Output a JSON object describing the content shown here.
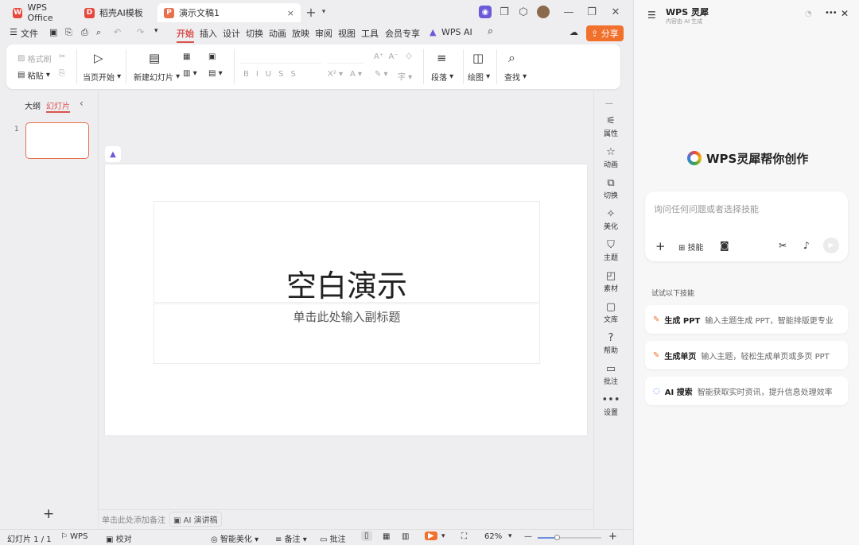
{
  "tabs": [
    {
      "label": "WPS Office",
      "icon": "wps-logo-icon"
    },
    {
      "label": "稻壳AI模板",
      "icon": "docer-icon"
    },
    {
      "label": "演示文稿1",
      "icon": "presentation-icon",
      "close": "×"
    }
  ],
  "menu": {
    "file": "文件",
    "items": [
      "开始",
      "插入",
      "设计",
      "切换",
      "动画",
      "放映",
      "审阅",
      "视图",
      "工具",
      "会员专享"
    ],
    "active": "开始",
    "wps_ai": "WPS AI",
    "share": "分享"
  },
  "ribbon": {
    "format_painter": "格式刷",
    "paste": "粘贴",
    "play_current": "当页开始",
    "new_slide": "新建幻灯片",
    "paragraph": "段落",
    "draw": "绘图",
    "find": "查找"
  },
  "left_panel": {
    "outline": "大纲",
    "slides": "幻灯片",
    "slide_number": "1",
    "add": "+"
  },
  "slide": {
    "title": "空白演示",
    "subtitle": "单击此处输入副标题"
  },
  "notes": {
    "placeholder": "单击此处添加备注",
    "ai_speech": "AI 演讲稿"
  },
  "tools": [
    "属性",
    "动画",
    "切换",
    "美化",
    "主题",
    "素材",
    "文库",
    "帮助",
    "批注",
    "设置"
  ],
  "status": {
    "slide_count": "幻灯片 1 / 1",
    "wps": "WPS",
    "proofread": "校对",
    "smart_beautify": "智能美化",
    "notes": "备注",
    "comments": "批注",
    "zoom": "62%"
  },
  "assistant": {
    "title": "WPS 灵犀",
    "subtitle": "内容由 AI 生成",
    "heading": "WPS灵犀帮你创作",
    "input_placeholder": "询问任何问题或者选择技能",
    "skills_btn": "技能",
    "try_label": "试试以下技能",
    "cards": [
      {
        "title": "生成 PPT",
        "desc": "输入主题生成 PPT，智能排版更专业"
      },
      {
        "title": "生成单页",
        "desc": "输入主题，轻松生成单页或多页 PPT"
      },
      {
        "title": "AI 搜索",
        "desc": "智能获取实时资讯，提升信息处理效率"
      }
    ]
  },
  "colors": {
    "accent": "#d9534f",
    "share_bg": "#f0702c",
    "thumb_border": "#e8704b"
  }
}
